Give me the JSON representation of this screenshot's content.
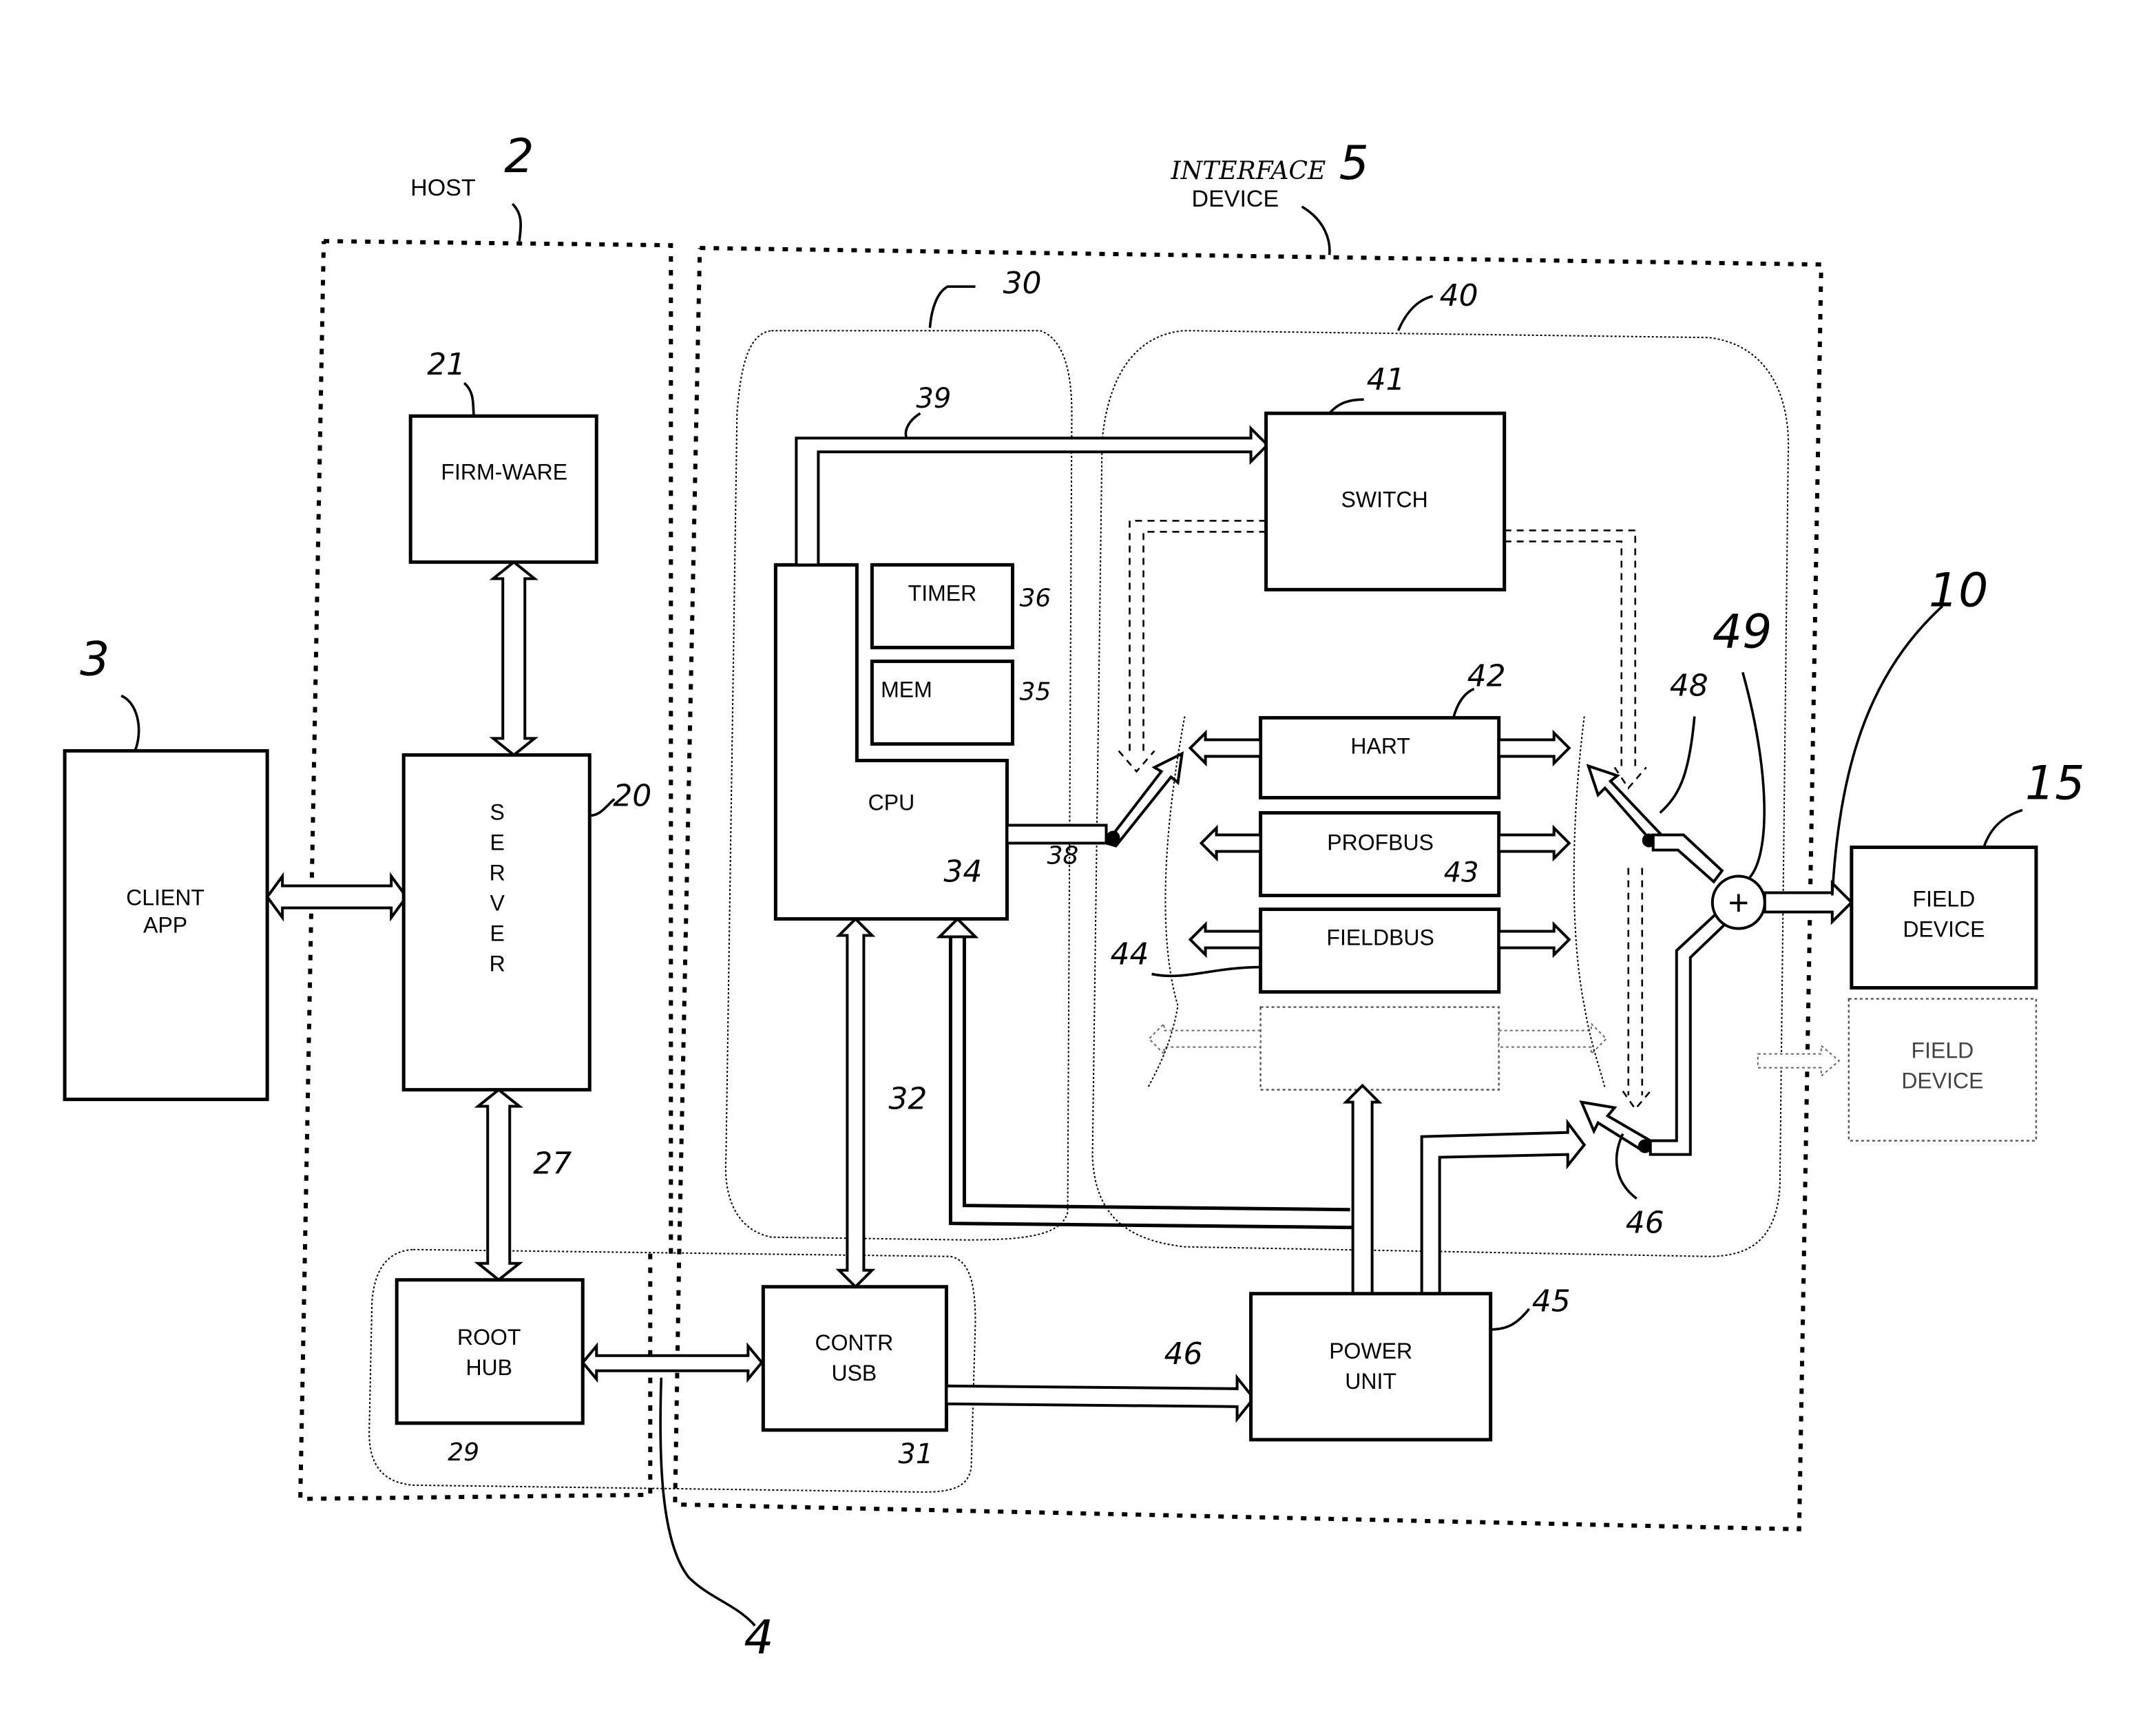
{
  "figure": {
    "regions": {
      "host": {
        "label": "HOST",
        "ref": "2"
      },
      "interface_device": {
        "label_line1": "INTERFACE",
        "label_line2": "DEVICE",
        "ref": "5"
      },
      "usb_link_ref": "4",
      "cpu_group_ref": "30",
      "protocol_group_ref": "40"
    },
    "blocks": {
      "client_app": {
        "line1": "CLIENT",
        "line2": "APP",
        "ref": "3"
      },
      "firmware": {
        "label": "FIRM-WARE",
        "ref": "21"
      },
      "server": {
        "letters": [
          "S",
          "E",
          "R",
          "V",
          "E",
          "R"
        ],
        "ref": "20"
      },
      "root_hub": {
        "line1": "ROOT",
        "line2": "HUB",
        "ref": "29"
      },
      "contr_usb": {
        "line1": "CONTR",
        "line2": "USB",
        "ref": "31"
      },
      "cpu": {
        "label": "CPU",
        "ref": "34"
      },
      "timer": {
        "label": "TIMER",
        "ref": "36"
      },
      "mem": {
        "label": "MEM",
        "ref": "35"
      },
      "switch": {
        "label": "SWITCH",
        "ref": "41"
      },
      "hart": {
        "label": "HART",
        "ref": "42"
      },
      "profibus": {
        "label": "PROFBUS",
        "ref": "43"
      },
      "fieldbus": {
        "label": "FIELDBUS",
        "ref": "44"
      },
      "power_unit": {
        "line1": "POWER",
        "line2": "UNIT",
        "ref": "45"
      },
      "field_device": {
        "line1": "FIELD",
        "line2": "DEVICE",
        "ref": "15"
      },
      "field_device_optional": {
        "line1": "FIELD",
        "line2": "DEVICE"
      }
    },
    "connections": {
      "server_roothub_ref": "27",
      "cpu_usb_ref": "32",
      "cpu_switch_ref": "39",
      "cpu_out_ref": "38",
      "usb_power_ref": "46",
      "lower_coupler_ref": "46",
      "upper_coupler_ref": "48",
      "summing_node_ref": "49",
      "summing_symbol": "+",
      "field_line_ref": "10"
    }
  }
}
